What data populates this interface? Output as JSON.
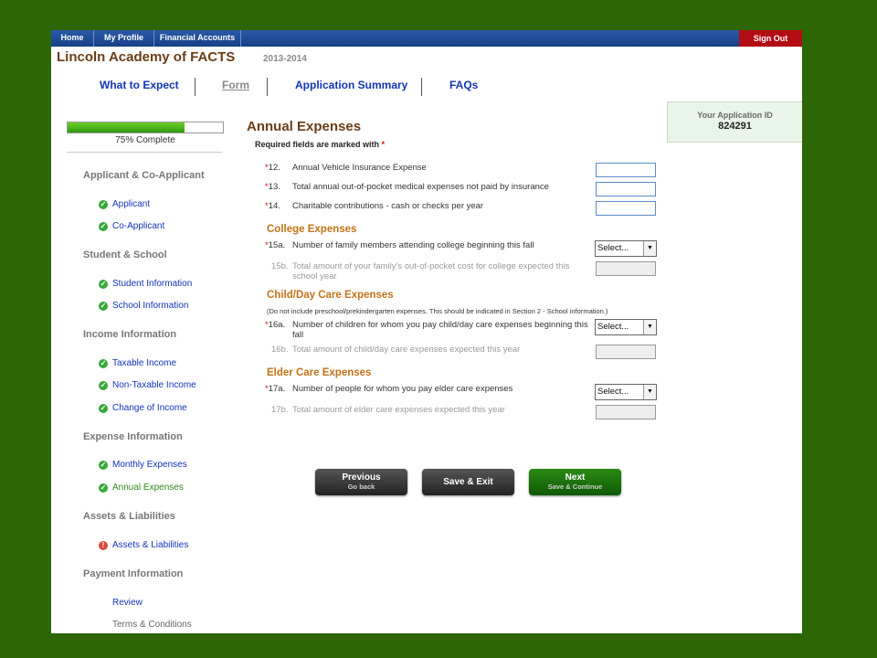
{
  "nav": {
    "home": "Home",
    "profile": "My Profile",
    "accounts": "Financial Accounts",
    "signout": "Sign Out"
  },
  "brand": {
    "title": "Lincoln Academy of FACTS",
    "year": "2013-2014"
  },
  "tabs": [
    "What to Expect",
    "Form",
    "Application Summary",
    "FAQs"
  ],
  "application": {
    "id_label": "Your Application ID",
    "id_value": "824291"
  },
  "progress": {
    "text": "75% Complete",
    "fraction": 0.75,
    "color": "#4fb81d"
  },
  "sidebar": {
    "sections": [
      "Applicant & Co-Applicant",
      "Student & School",
      "Income Information",
      "Expense Information",
      "Assets & Liabilities",
      "Payment Information"
    ],
    "items": [
      "Applicant",
      "Co-Applicant",
      "Student Information",
      "School Information",
      "Taxable Income",
      "Non-Taxable Income",
      "Change of Income",
      "Monthly Expenses",
      "Annual Expenses",
      "Assets & Liabilities",
      "Review",
      "Terms & Conditions"
    ]
  },
  "form": {
    "title": "Annual Expenses",
    "required_note": "Required fields are marked with",
    "required_mark": "*",
    "q12": {
      "num": "12.",
      "text": "Annual Vehicle Insurance Expense",
      "value": ""
    },
    "q13": {
      "num": "13.",
      "text": "Total annual out-of-pocket medical expenses not paid by insurance",
      "value": ""
    },
    "q14": {
      "num": "14.",
      "text": "Charitable contributions - cash or checks per year",
      "value": ""
    },
    "college_head": "College Expenses",
    "q15a": {
      "num": "15a.",
      "text": "Number of family members attending college beginning this fall",
      "selected": "Select..."
    },
    "q15b": {
      "num": "15b.",
      "text": "Total amount of your family's out-of-pocket cost for college expected this school year"
    },
    "childcare_head": "Child/Day Care Expenses",
    "childcare_note": "(Do not include preschool/prekindergarten expenses. This should be indicated in Section 2 - School information.)",
    "q16a": {
      "num": "16a.",
      "text": "Number of children for whom you pay child/day care expenses beginning this fall",
      "selected": "Select..."
    },
    "q16b": {
      "num": "16b.",
      "text": "Total amount of child/day care expenses expected this year"
    },
    "eldercare_head": "Elder Care Expenses",
    "q17a": {
      "num": "17a.",
      "text": "Number of people for whom you pay elder care expenses",
      "selected": "Select..."
    },
    "q17b": {
      "num": "17b.",
      "text": "Total amount of elder care expenses expected this year"
    }
  },
  "buttons": {
    "previous": "Previous",
    "previous_sub": "Go back",
    "save_exit": "Save & Exit",
    "next": "Next",
    "next_sub": "Save & Continue"
  },
  "colors": {
    "accent_brown": "#6a3d16",
    "section_orange": "#c27317",
    "link_blue": "#1235b8",
    "signout_red": "#b30d14"
  }
}
